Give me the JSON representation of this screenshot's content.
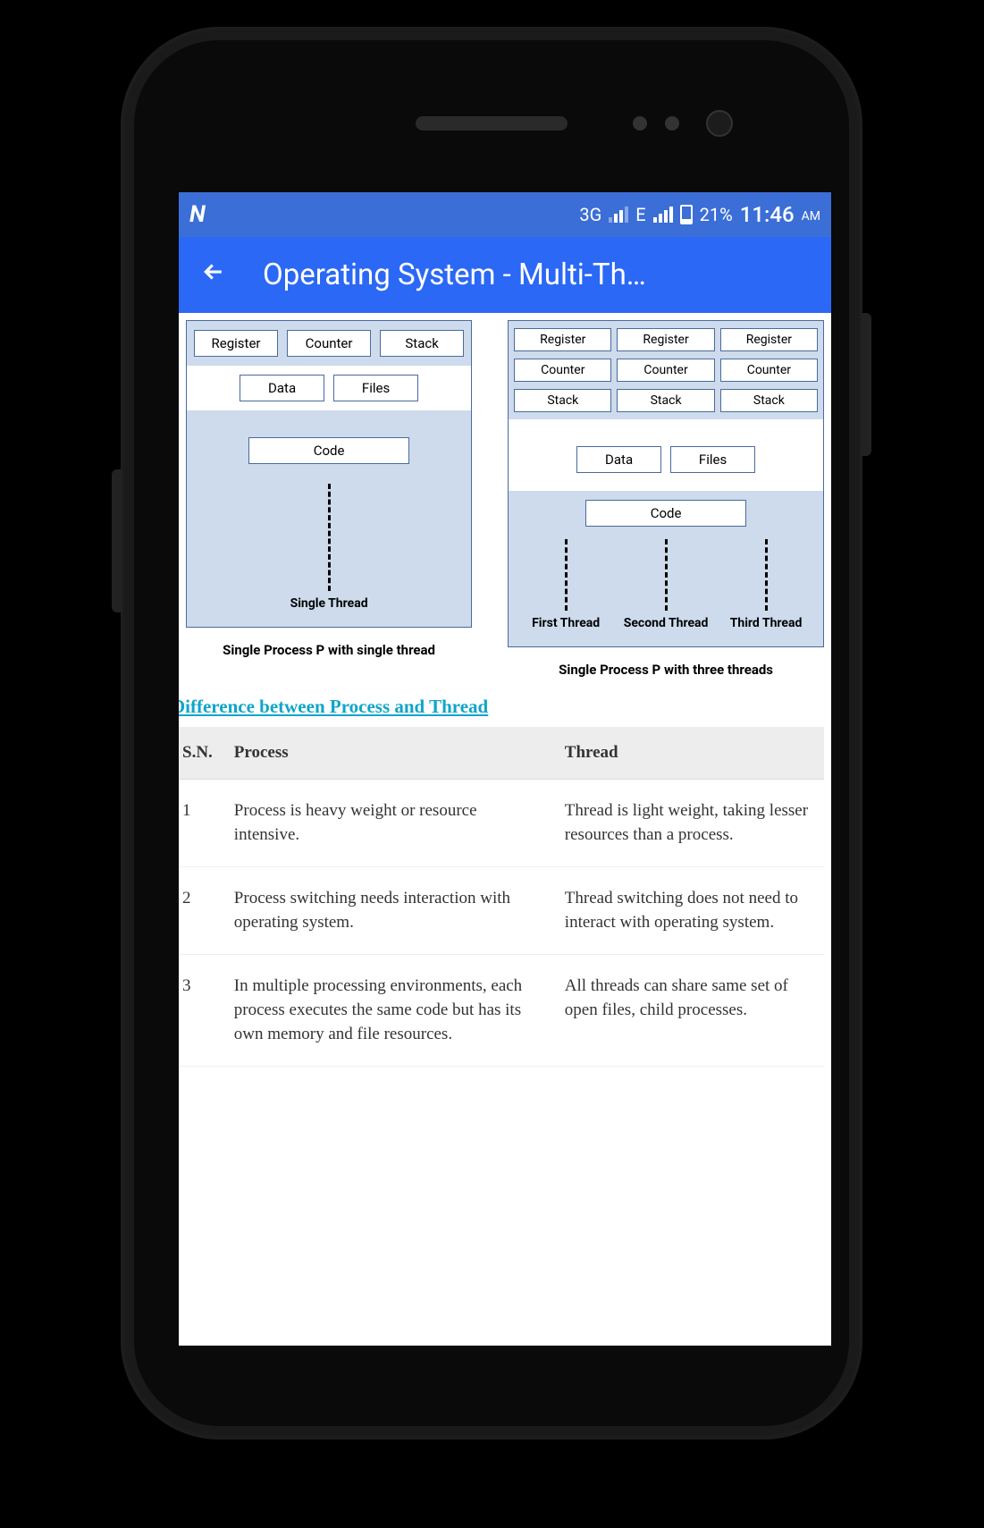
{
  "status_bar": {
    "logo": "N",
    "net1": "3G",
    "net2": "E",
    "battery_pct": "21%",
    "time": "11:46",
    "ampm": "AM"
  },
  "app_bar": {
    "title": "Operating System - Multi-Th…"
  },
  "diagram_single": {
    "row1": [
      "Register",
      "Counter",
      "Stack"
    ],
    "row2": [
      "Data",
      "Files"
    ],
    "code": "Code",
    "thread_label": "Single Thread",
    "caption": "Single Process P with single thread"
  },
  "diagram_multi": {
    "cols": [
      [
        "Register",
        "Counter",
        "Stack"
      ],
      [
        "Register",
        "Counter",
        "Stack"
      ],
      [
        "Register",
        "Counter",
        "Stack"
      ]
    ],
    "row2": [
      "Data",
      "Files"
    ],
    "code": "Code",
    "thread_labels": [
      "First Thread",
      "Second Thread",
      "Third Thread"
    ],
    "caption": "Single Process P with three threads"
  },
  "section_heading": "Difference between Process and Thread",
  "table": {
    "headers": [
      "S.N.",
      "Process",
      "Thread"
    ],
    "rows": [
      {
        "sn": "1",
        "process": "Process is heavy weight or resource intensive.",
        "thread": "Thread is light weight, taking lesser resources than a process."
      },
      {
        "sn": "2",
        "process": "Process switching needs interaction with operating system.",
        "thread": "Thread switching does not need to interact with operating system."
      },
      {
        "sn": "3",
        "process": "In multiple processing environments, each process executes the same code but has its own memory and file resources.",
        "thread": "All threads can share same set of open files, child processes."
      }
    ]
  }
}
